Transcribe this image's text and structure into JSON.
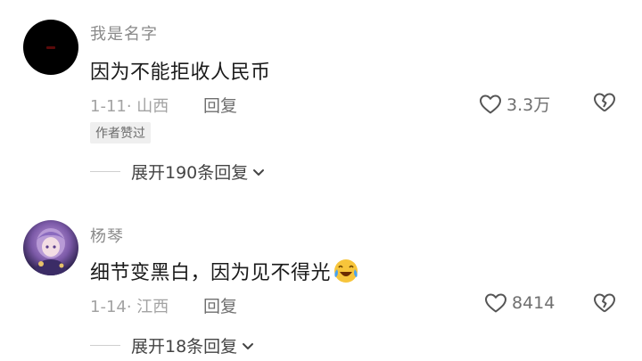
{
  "comments": [
    {
      "username": "我是名字",
      "content": "因为不能拒收人民币",
      "meta": "1-11· 山西",
      "reply_label": "回复",
      "like_count": "3.3万",
      "badge": "作者赞过",
      "expand_label": "展开190条回复",
      "avatar": "black-avatar"
    },
    {
      "username": "杨琴",
      "content": "细节变黑白，因为见不得光",
      "emoji": "laughing-crying-emoji",
      "meta": "1-14· 江西",
      "reply_label": "回复",
      "like_count": "8414",
      "expand_label": "展开18条回复",
      "avatar": "anime-girl-avatar"
    }
  ],
  "icons": {
    "like": "heart-outline-icon",
    "dislike": "broken-heart-icon",
    "expand": "chevron-down-icon"
  },
  "colors": {
    "text_primary": "#1a1a1a",
    "text_secondary": "#8a8a8a",
    "badge_bg": "#efefef"
  }
}
